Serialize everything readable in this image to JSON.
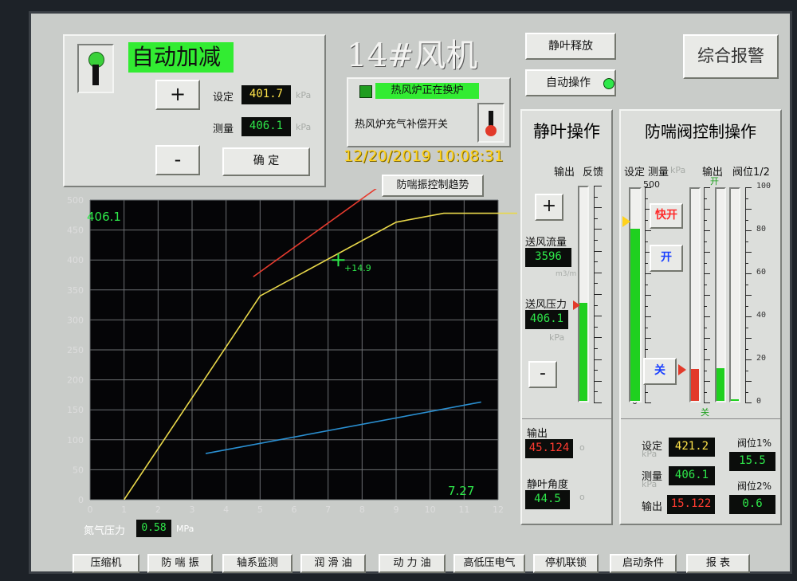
{
  "title": "14#风机",
  "auto_panel": {
    "mode_label": "自动加减",
    "plus": "+",
    "minus": "-",
    "set_label": "设定",
    "set_value": "401.7",
    "meas_label": "测量",
    "meas_value": "406.1",
    "unit": "kPa",
    "confirm": "确 定"
  },
  "furnace": {
    "status": "热风炉正在换炉",
    "switch_label": "热风炉充气补偿开关"
  },
  "datetime": "12/20/2019 10:08:31",
  "buttons": {
    "vane_release": "静叶释放",
    "auto_op": "自动操作",
    "alarm": "综合报警",
    "trend": "防喘振控制趋势"
  },
  "vane_panel": {
    "title": "静叶操作",
    "out_label": "输出",
    "fb_label": "反馈",
    "plus": "+",
    "minus": "-",
    "flow_label": "送风流量",
    "flow_value": "3596",
    "flow_unit": "m3/m",
    "press_label": "送风压力",
    "press_value": "406.1",
    "press_unit": "kPa",
    "output_label": "输出",
    "output_value": "45.124",
    "angle_label": "静叶角度",
    "angle_value": "44.5",
    "output_level": 0.46,
    "feedback_level": 0.45,
    "scale_marks": [
      "o",
      "o"
    ]
  },
  "surge_panel": {
    "title": "防喘阀控制操作",
    "set_label": "设定",
    "meas_label": "测量",
    "unit": "kPa",
    "out_label": "输出",
    "pos_label": "阀位1/2",
    "open_label": "开",
    "close_label": "关",
    "scale_top": "500",
    "scale_bottom": "0",
    "btn_fast_open": "快开",
    "btn_open": "开",
    "btn_close": "关",
    "pos_scale": [
      "100",
      "80",
      "60",
      "40",
      "20",
      "0"
    ],
    "set_value": "421.2",
    "meas_value": "406.1",
    "output_value": "15.122",
    "pos1_label": "阀位1%",
    "pos1_value": "15.5",
    "pos2_label": "阀位2%",
    "pos2_value": "0.6",
    "meas_level": 0.812,
    "set_level": 0.842,
    "out_level": 0.151,
    "pos1_level": 0.155,
    "pos2_level": 0.006
  },
  "chart_data": {
    "type": "line",
    "corner_top": "406.1",
    "corner_bottom": "7.27",
    "marker_label": "+14.9",
    "x_ticks": [
      "0",
      "1",
      "2",
      "3",
      "4",
      "5",
      "6",
      "7",
      "8",
      "9",
      "10",
      "11",
      "12"
    ],
    "y_ticks": [
      "0",
      "50",
      "100",
      "150",
      "200",
      "250",
      "300",
      "350",
      "400",
      "450",
      "500"
    ],
    "xlim": [
      0,
      12
    ],
    "ylim": [
      0,
      500
    ],
    "grid": true,
    "series": [
      {
        "color": "#e9d84a",
        "x": [
          1,
          5,
          9,
          10.4,
          13.2
        ],
        "y": [
          0,
          340,
          463,
          478,
          478
        ]
      },
      {
        "color": "#e63b2e",
        "x": [
          4.8,
          10.3
        ],
        "y": [
          372,
          596
        ]
      },
      {
        "color": "#2a8fd1",
        "x": [
          3.4,
          11.5
        ],
        "y": [
          77,
          163
        ]
      }
    ],
    "marker": {
      "x": 7.3,
      "y": 400,
      "color": "#2ee84a"
    }
  },
  "nitrogen": {
    "label": "氮气压力",
    "value": "0.58",
    "unit": "MPa"
  },
  "nav": [
    "压缩机",
    "防 喘 振",
    "轴系监测",
    "润 滑 油",
    "动 力 油",
    "高低压电气",
    "停机联锁",
    "启动条件",
    "报  表"
  ]
}
